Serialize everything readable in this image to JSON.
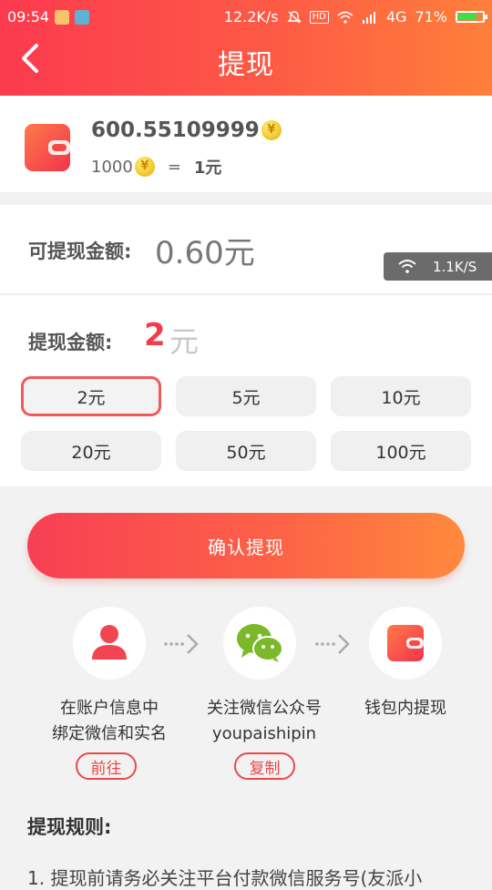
{
  "status_bar": {
    "time": "09:54",
    "net_speed": "12.2K/s",
    "hd": "HD",
    "network": "4G",
    "battery": "71%",
    "battery_level": 0.71,
    "icons": [
      "package-icon",
      "scan-icon",
      "mute-icon",
      "wifi-icon",
      "signal-icon",
      "battery-icon"
    ]
  },
  "header": {
    "title": "提现",
    "back_icon": "chevron-left-icon"
  },
  "balance": {
    "amount": "600.55109999",
    "rate_coins": "1000",
    "rate_eq": "=",
    "rate_value": "1元",
    "icon": "wallet-icon"
  },
  "available": {
    "label": "可提现金额:",
    "value": "0.60元"
  },
  "net_overlay": {
    "speed": "1.1K/S",
    "icon": "wifi-icon"
  },
  "withdraw": {
    "label": "提现金额:",
    "value": "2",
    "unit": "元",
    "options": [
      "2元",
      "5元",
      "10元",
      "20元",
      "50元",
      "100元"
    ],
    "selected": "2元"
  },
  "confirm_label": "确认提现",
  "steps": [
    {
      "icon": "user-icon",
      "text1": "在账户信息中",
      "text2": "绑定微信和实名",
      "button": "前往"
    },
    {
      "icon": "wechat-icon",
      "text1": "关注微信公众号",
      "text2": "youpaishipin",
      "button": "复制"
    },
    {
      "icon": "wallet-icon",
      "text1": "钱包内提现",
      "text2": ""
    }
  ],
  "rules": {
    "title": "提现规则:",
    "line1": "1. 提现前请务必关注平台付款微信服务号(友派小"
  },
  "colors": {
    "brand_start": "#fb3a4f",
    "brand_end": "#ff7f3a",
    "accent_red": "#f33d4e"
  }
}
